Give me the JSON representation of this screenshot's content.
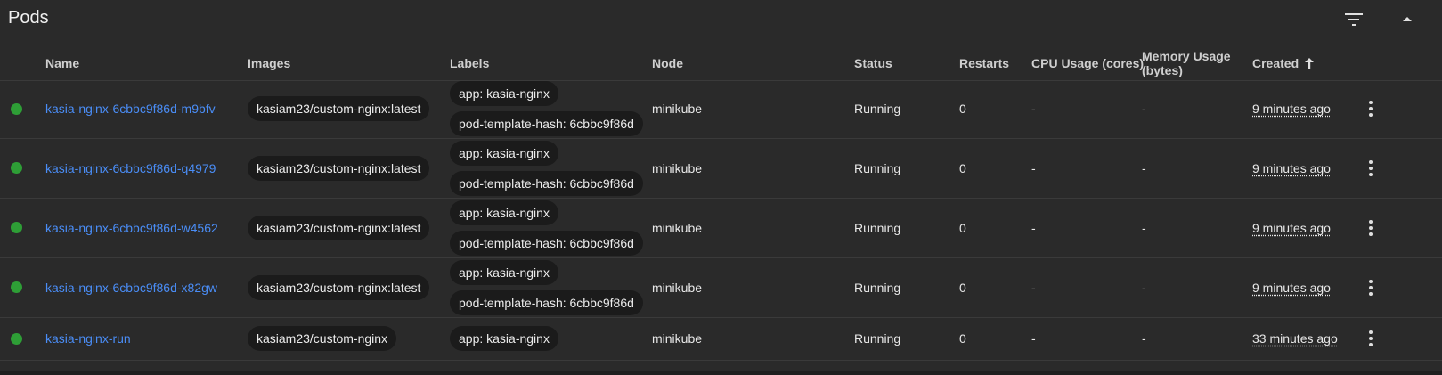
{
  "panel": {
    "title": "Pods",
    "filter_icon": "filter-list-icon",
    "collapse_icon": "arrow-drop-up-icon"
  },
  "columns": {
    "name": "Name",
    "images": "Images",
    "labels": "Labels",
    "node": "Node",
    "status": "Status",
    "restarts": "Restarts",
    "cpu": "CPU Usage (cores)",
    "memory_line1": "Memory Usage",
    "memory_line2": "(bytes)",
    "created": "Created",
    "created_sort_icon": "arrow-upward-icon"
  },
  "colors": {
    "status_running": "#2e9e36",
    "link": "#4a8df6"
  },
  "rows": [
    {
      "name": "kasia-nginx-6cbbc9f86d-m9bfv",
      "image": "kasiam23/custom-nginx:latest",
      "labels": [
        "app: kasia-nginx",
        "pod-template-hash: 6cbbc9f86d"
      ],
      "node": "minikube",
      "status": "Running",
      "restarts": "0",
      "cpu": "-",
      "memory": "-",
      "created": "9 minutes ago"
    },
    {
      "name": "kasia-nginx-6cbbc9f86d-q4979",
      "image": "kasiam23/custom-nginx:latest",
      "labels": [
        "app: kasia-nginx",
        "pod-template-hash: 6cbbc9f86d"
      ],
      "node": "minikube",
      "status": "Running",
      "restarts": "0",
      "cpu": "-",
      "memory": "-",
      "created": "9 minutes ago"
    },
    {
      "name": "kasia-nginx-6cbbc9f86d-w4562",
      "image": "kasiam23/custom-nginx:latest",
      "labels": [
        "app: kasia-nginx",
        "pod-template-hash: 6cbbc9f86d"
      ],
      "node": "minikube",
      "status": "Running",
      "restarts": "0",
      "cpu": "-",
      "memory": "-",
      "created": "9 minutes ago"
    },
    {
      "name": "kasia-nginx-6cbbc9f86d-x82gw",
      "image": "kasiam23/custom-nginx:latest",
      "labels": [
        "app: kasia-nginx",
        "pod-template-hash: 6cbbc9f86d"
      ],
      "node": "minikube",
      "status": "Running",
      "restarts": "0",
      "cpu": "-",
      "memory": "-",
      "created": "9 minutes ago"
    },
    {
      "name": "kasia-nginx-run",
      "image": "kasiam23/custom-nginx",
      "labels": [
        "app: kasia-nginx"
      ],
      "node": "minikube",
      "status": "Running",
      "restarts": "0",
      "cpu": "-",
      "memory": "-",
      "created": "33 minutes ago"
    }
  ]
}
